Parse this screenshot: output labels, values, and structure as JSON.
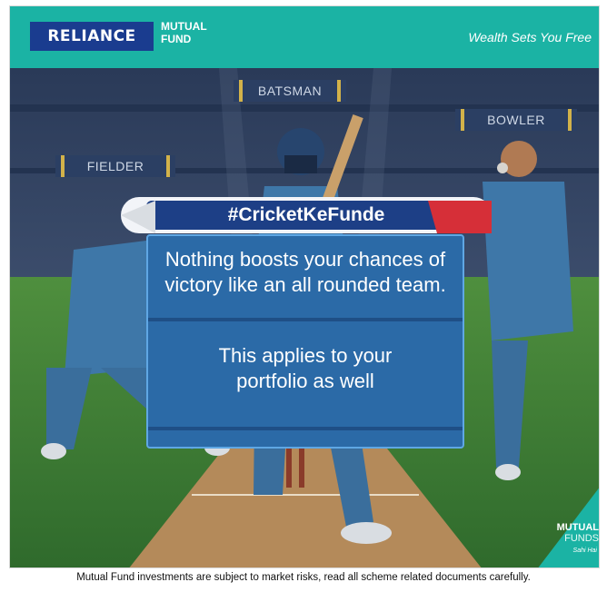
{
  "header": {
    "brand": "RELIANCE",
    "brand_sub": "MUTUAL\nFUND",
    "tagline": "Wealth Sets You Free"
  },
  "roles": {
    "batsman": "BATSMAN",
    "bowler": "BOWLER",
    "fielder": "FIELDER"
  },
  "banner": {
    "hashtag": "#CricketKeFunde"
  },
  "card": {
    "line1": "Nothing boosts your chances of\nvictory like an all rounded team.",
    "line2": "This applies to your\nportfolio as well"
  },
  "corner_badge": {
    "line1": "MUTUAL",
    "line2": "FUNDS",
    "line3": "Sahi Hai"
  },
  "disclaimer": "Mutual Fund investments are subject to market risks, read all scheme related documents carefully.",
  "colors": {
    "header_teal": "#1bb3a4",
    "brand_blue": "#1a3c8f",
    "card_blue": "#2b6aa7",
    "pitch_green": "#3f7d3a",
    "pitch_brown": "#b48a5a"
  }
}
